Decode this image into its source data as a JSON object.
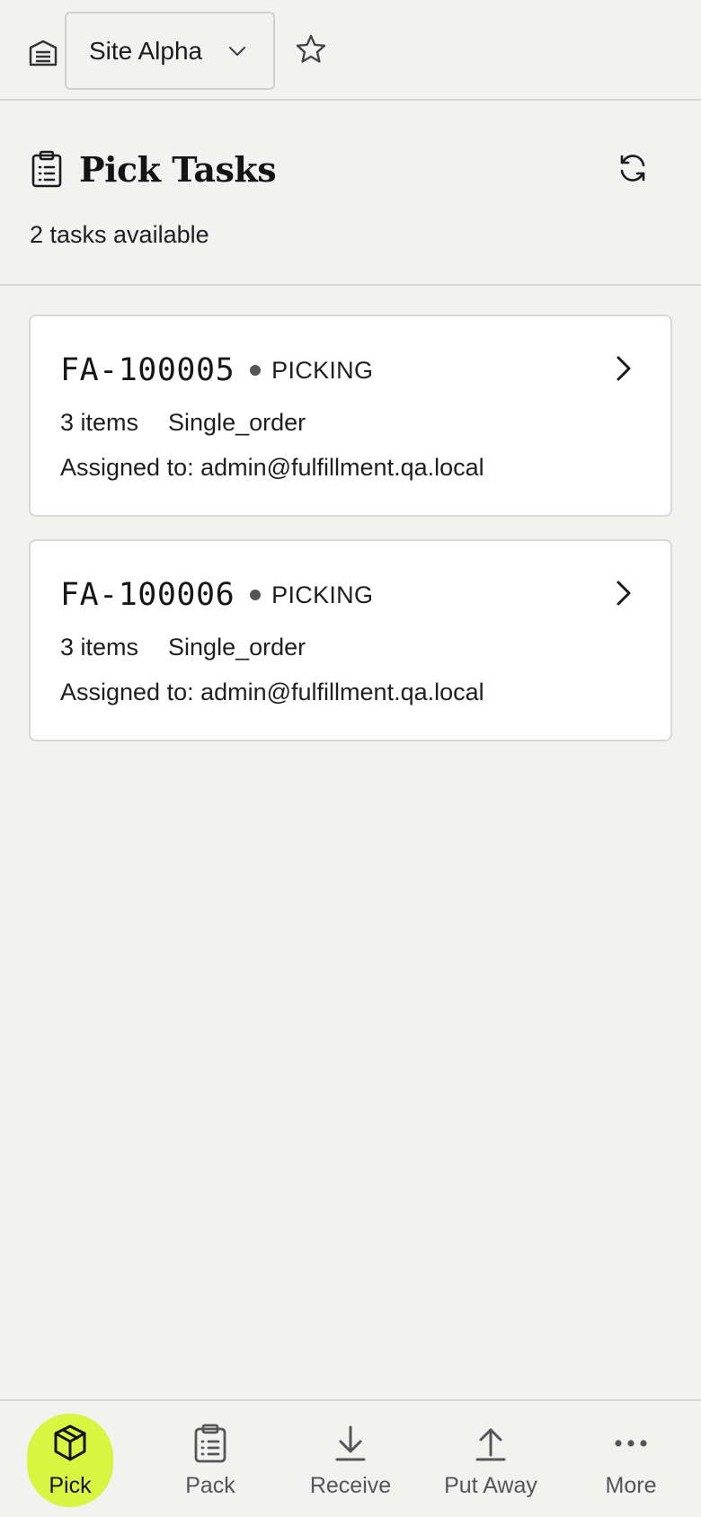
{
  "topbar": {
    "site_selected": "Site Alpha",
    "icons": [
      "warehouse-icon",
      "chevron-down-icon",
      "star-icon"
    ]
  },
  "header": {
    "title": "Pick Tasks",
    "subtitle": "2 tasks available",
    "icons": [
      "clipboard-icon",
      "refresh-icon"
    ]
  },
  "tasks": [
    {
      "id": "FA-100005",
      "status": "PICKING",
      "items": "3 items",
      "type": "Single_order",
      "assigned": "Assigned to: admin@fulfillment.qa.local"
    },
    {
      "id": "FA-100006",
      "status": "PICKING",
      "items": "3 items",
      "type": "Single_order",
      "assigned": "Assigned to: admin@fulfillment.qa.local"
    }
  ],
  "nav": [
    {
      "label": "Pick",
      "icon": "box-icon",
      "active": true
    },
    {
      "label": "Pack",
      "icon": "clipboard-list-icon",
      "active": false
    },
    {
      "label": "Receive",
      "icon": "download-icon",
      "active": false
    },
    {
      "label": "Put Away",
      "icon": "upload-icon",
      "active": false
    },
    {
      "label": "More",
      "icon": "more-icon",
      "active": false
    }
  ],
  "colors": {
    "background": "#f2f2f1",
    "card": "#ffffff",
    "accent": "#d8f542",
    "border": "#d6d6d4"
  }
}
